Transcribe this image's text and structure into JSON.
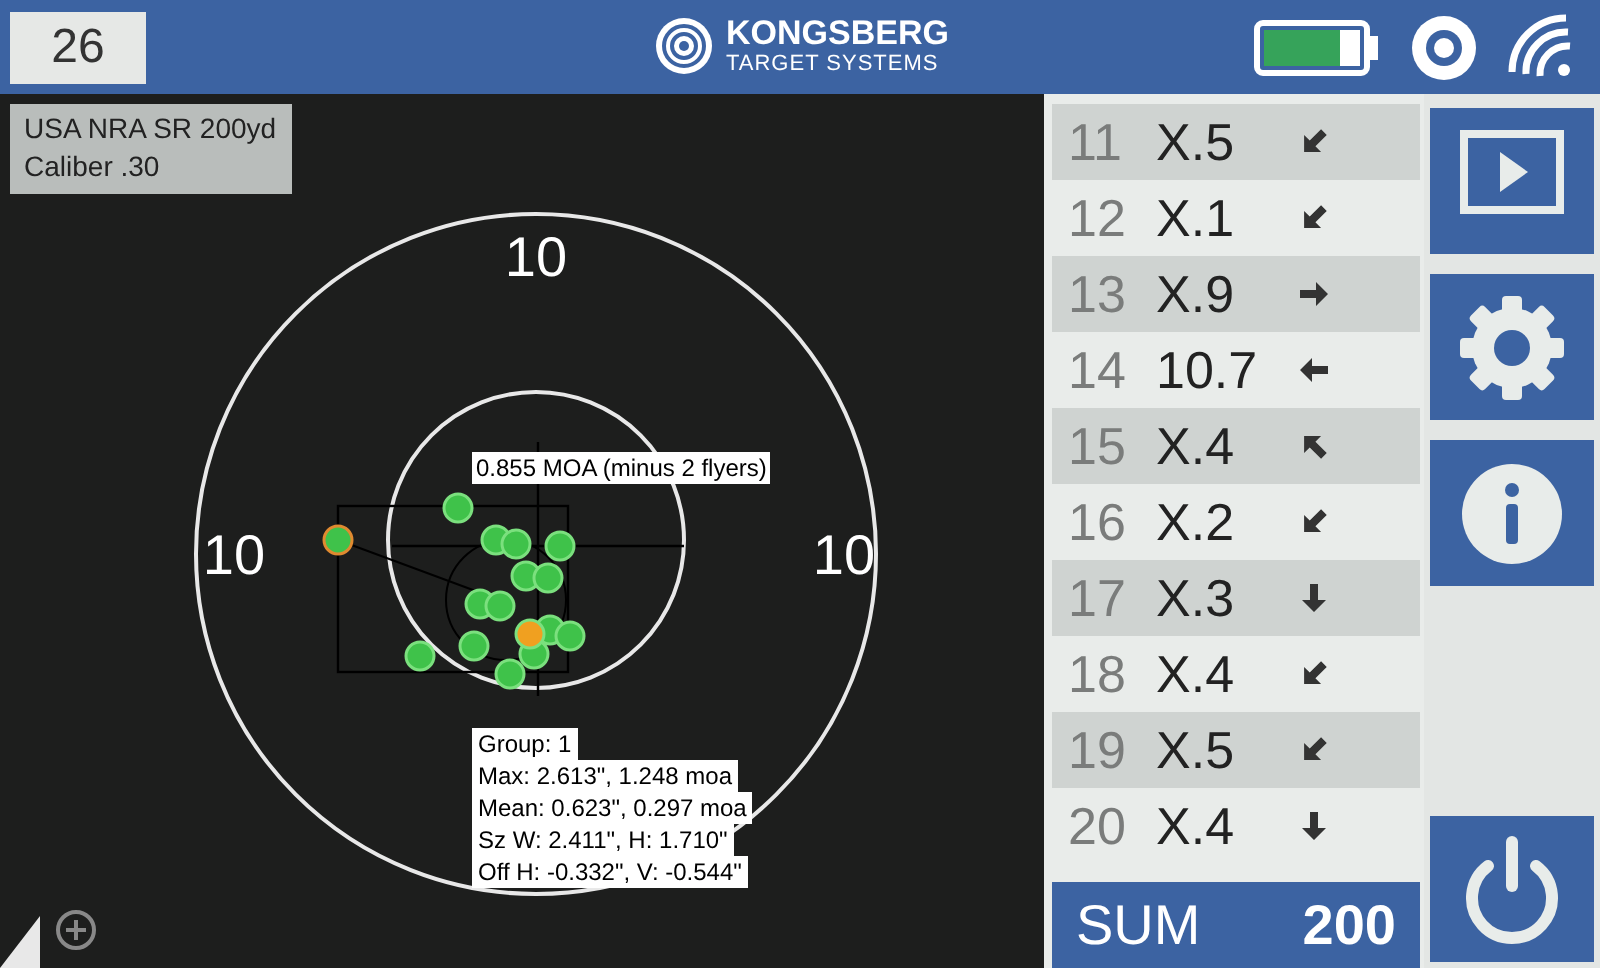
{
  "header": {
    "shot_count": "26",
    "logo": {
      "name": "KONGSBERG",
      "tagline": "TARGET SYSTEMS"
    }
  },
  "target_info": {
    "lines": [
      "USA NRA SR 200yd",
      "Caliber .30"
    ]
  },
  "target": {
    "ring_labels": [
      "10",
      "10",
      "10"
    ],
    "group_label": "0.855 MOA (minus 2 flyers)",
    "stats": [
      "Group: 1",
      "Max: 2.613\", 1.248 moa",
      "Mean: 0.623\", 0.297 moa",
      "Sz W: 2.411\", H: 1.710\"",
      "Off H: -0.332\", V: -0.544\""
    ]
  },
  "shots": [
    {
      "number": "11",
      "score": "X.5",
      "kind": "sw"
    },
    {
      "number": "12",
      "score": "X.1",
      "kind": "sw"
    },
    {
      "number": "13",
      "score": "X.9",
      "kind": "e"
    },
    {
      "number": "14",
      "score": "10.7",
      "kind": "w"
    },
    {
      "number": "15",
      "score": "X.4",
      "kind": "nw"
    },
    {
      "number": "16",
      "score": "X.2",
      "kind": "sw"
    },
    {
      "number": "17",
      "score": "X.3",
      "kind": "s"
    },
    {
      "number": "18",
      "score": "X.4",
      "kind": "sw"
    },
    {
      "number": "19",
      "score": "X.5",
      "kind": "sw"
    },
    {
      "number": "20",
      "score": "X.4",
      "kind": "s"
    }
  ],
  "sum": {
    "label": "SUM",
    "value": "200"
  },
  "buttons": [
    {
      "kind": "play"
    },
    {
      "kind": "settings"
    },
    {
      "kind": "info"
    },
    {
      "kind": "power"
    }
  ]
}
